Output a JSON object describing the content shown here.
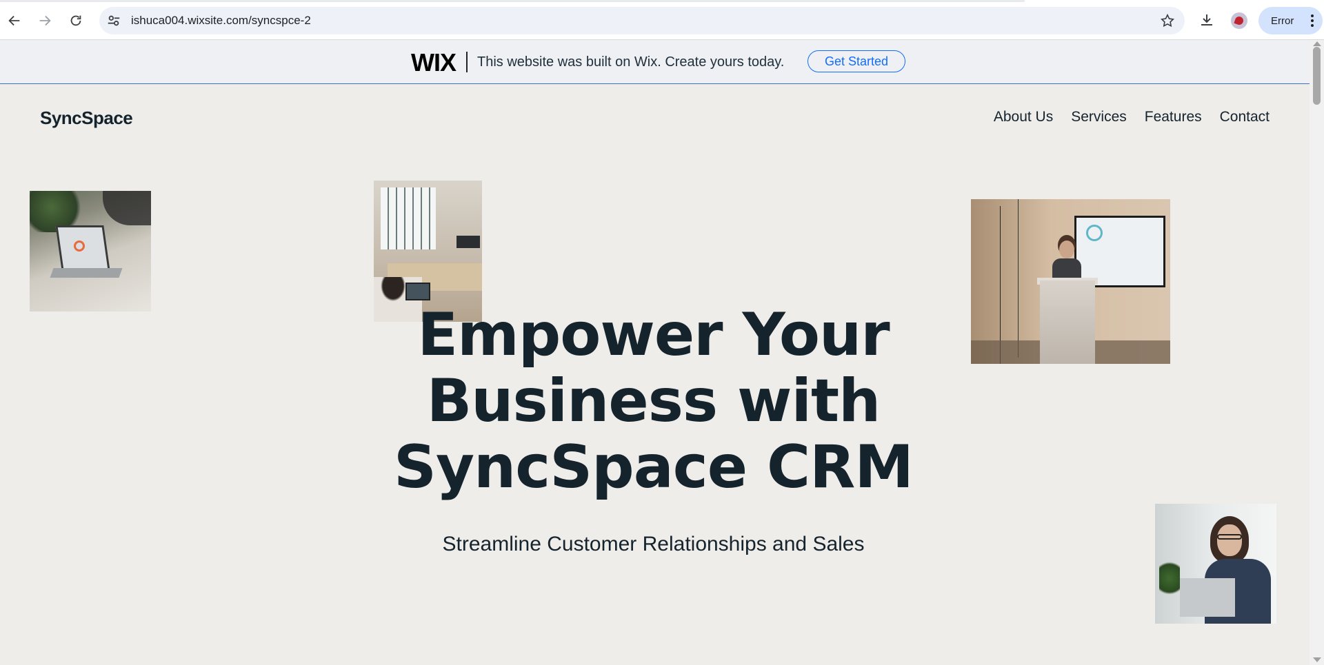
{
  "browser": {
    "url": "ishuca004.wixsite.com/syncspce-2",
    "profile_button_label": "Error",
    "icons": {
      "back": "back-arrow-icon",
      "forward": "forward-arrow-icon",
      "reload": "reload-icon",
      "site_info": "tune-icon",
      "bookmark": "star-icon",
      "downloads": "download-icon",
      "menu": "kebab-menu-icon"
    }
  },
  "wix_banner": {
    "logo": "WIX",
    "text": "This website was built on Wix. Create yours today.",
    "cta_label": "Get Started",
    "accent_color": "#116dff"
  },
  "site": {
    "logo": "SyncSpace",
    "nav": [
      {
        "label": "About Us"
      },
      {
        "label": "Services"
      },
      {
        "label": "Features"
      },
      {
        "label": "Contact"
      }
    ],
    "hero_lines": [
      "Empower Your",
      "Business with",
      "SyncSpace CRM"
    ],
    "subtitle": "Streamline Customer Relationships and Sales",
    "text_color": "#15232d",
    "background_color": "#efedea"
  }
}
